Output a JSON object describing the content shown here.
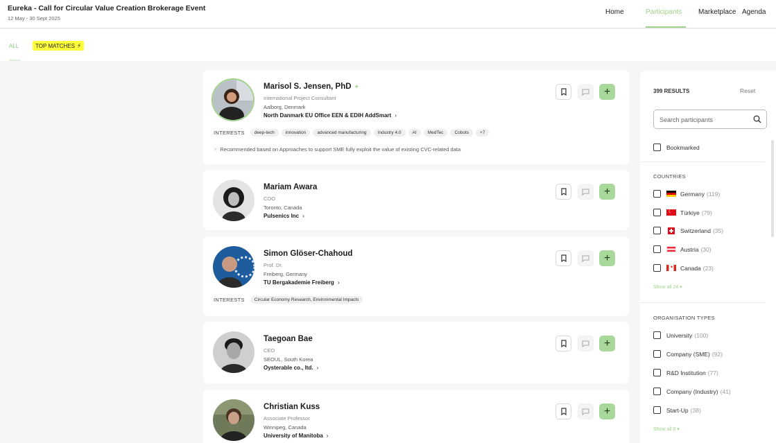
{
  "header": {
    "event_title": "Eureka - Call for Circular Value Creation Brokerage Event",
    "event_dates": "12 May - 30 Sept 2025",
    "nav": [
      {
        "label": "Home",
        "active": false
      },
      {
        "label": "Participants",
        "active": true
      },
      {
        "label": "Marketplace",
        "active": false
      },
      {
        "label": "Agenda",
        "active": false
      }
    ]
  },
  "tabs": {
    "all": "ALL",
    "top_matches": "TOP MATCHES"
  },
  "interests_label": "INTERESTS",
  "participants": [
    {
      "name": "Marisol S. Jensen, PhD",
      "role": "International Project Consultant",
      "location": "Aalborg, Denmark",
      "organisation": "North Danmark EU Office EEN & EDIH AddSmart",
      "interests": [
        "deep-tech",
        "innovation",
        "advanced manufacturing",
        "Industry 4.0",
        "AI",
        "MedTec",
        "Cobots",
        "+7"
      ],
      "recommendation": "Recommended based on Approaches to support SME fully exploit the value of existing CVC-related data"
    },
    {
      "name": "Mariam Awara",
      "role": "COO",
      "location": "Toronto, Canada",
      "organisation": "Pulsenics Inc"
    },
    {
      "name": "Simon Glöser-Chahoud",
      "role": "Prof. Dr.",
      "location": "Freiberg, Germany",
      "organisation": "TU Bergakademie Freiberg",
      "interests": [
        "Circular Economy Research, Environmental Impacts"
      ]
    },
    {
      "name": "Taegoan Bae",
      "role": "CEO",
      "location": "SEOUL, South Korea",
      "organisation": "Oysterable co., ltd."
    },
    {
      "name": "Christian Kuss",
      "role": "Associate Professor",
      "location": "Winnipeg, Canada",
      "organisation": "University of Manitoba"
    }
  ],
  "filters": {
    "results": "399 RESULTS",
    "reset": "Reset",
    "search_placeholder": "Search participants",
    "bookmarked": "Bookmarked",
    "countries_title": "COUNTRIES",
    "countries": [
      {
        "name": "Germany",
        "count": "(119)"
      },
      {
        "name": "Türkiye",
        "count": "(79)"
      },
      {
        "name": "Switzerland",
        "count": "(35)"
      },
      {
        "name": "Austria",
        "count": "(30)"
      },
      {
        "name": "Canada",
        "count": "(23)"
      }
    ],
    "countries_show_all": "Show all 24",
    "org_types_title": "ORGANISATION TYPES",
    "org_types": [
      {
        "name": "University",
        "count": "(100)"
      },
      {
        "name": "Company (SME)",
        "count": "(92)"
      },
      {
        "name": "R&D Institution",
        "count": "(77)"
      },
      {
        "name": "Company (Industry)",
        "count": "(41)"
      },
      {
        "name": "Start-Up",
        "count": "(38)"
      }
    ],
    "org_types_show_all": "Show all 8"
  },
  "colors": {
    "accent": "#9fd38b",
    "add_button": "#a9d99a",
    "highlight": "#ffff3a"
  }
}
